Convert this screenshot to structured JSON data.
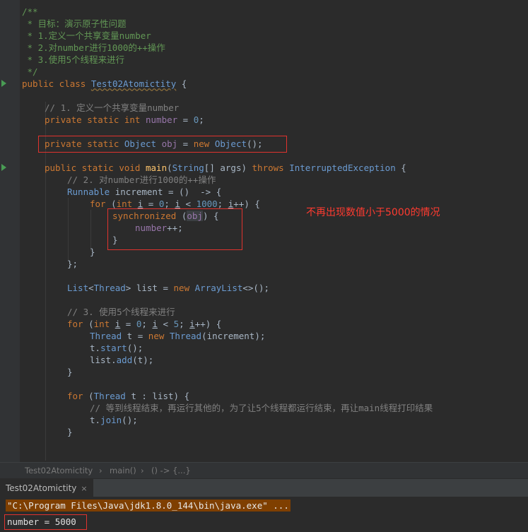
{
  "code": {
    "doc_open": "/**",
    "doc1": " * 目标：演示原子性问题",
    "doc2": " * 1.定义一个共享变量number",
    "doc3": " * 2.对number进行1000的++操作",
    "doc4": " * 3.使用5个线程来进行",
    "doc_close": " */",
    "class_name": "Test02Atomictity",
    "c1": "// 1. 定义一个共享变量number",
    "c2": "// 2. 对number进行1000的++操作",
    "c3": "// 3. 使用5个线程来进行",
    "c4": "// 等到线程结束，再运行其他的，为了让5个线程都运行结束，再让main线程打印结果",
    "var_number": "number",
    "var_obj": "obj",
    "type_object": "Object",
    "type_string": "String",
    "type_runnable": "Runnable",
    "type_thread": "Thread",
    "type_list": "List",
    "type_arraylist": "ArrayList",
    "exception": "InterruptedException",
    "method_main": "main",
    "kw_synchronized": "synchronized",
    "num_zero": "0",
    "num_thousand": "1000",
    "num_five": "5"
  },
  "annotation": "不再出现数值小于5000的情况",
  "breadcrumb": {
    "class": "Test02Atomictity",
    "method": "main()",
    "lambda": "() -> {...}"
  },
  "run_tab": {
    "label": "Test02Atomictity",
    "close": "×"
  },
  "console": {
    "command": "\"C:\\Program Files\\Java\\jdk1.8.0_144\\bin\\java.exe\" ...",
    "output": "number = 5000"
  },
  "colors": {
    "background": "#2b2b2b",
    "keyword": "#cc7832",
    "comment": "#629755",
    "line_comment": "#808080",
    "number": "#6897bb",
    "field": "#9876aa",
    "highlight_box": "#e0332e",
    "annotation": "#ff3b30"
  }
}
